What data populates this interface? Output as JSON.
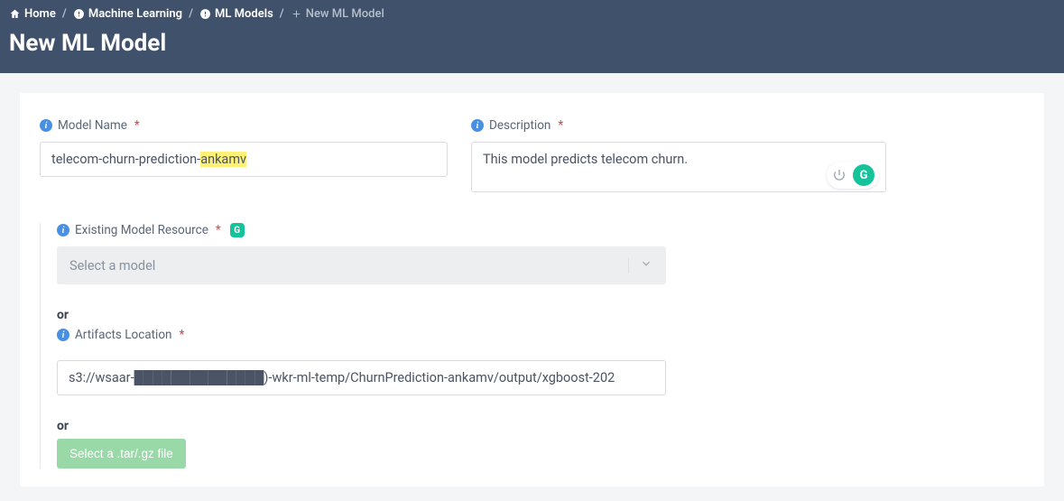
{
  "breadcrumb": {
    "home": "Home",
    "ml": "Machine Learning",
    "models": "ML Models",
    "new": "New ML Model"
  },
  "page_title": "New ML Model",
  "fields": {
    "model_name": {
      "label": "Model Name",
      "value_prefix": "telecom-churn-prediction-",
      "value_highlight": "ankamv"
    },
    "description": {
      "label": "Description",
      "value": "This model predicts telecom churn."
    },
    "existing_resource": {
      "label": "Existing Model Resource",
      "placeholder": "Select a model"
    },
    "artifacts": {
      "label": "Artifacts Location",
      "value": "s3://wsaar-██████████████)-wkr-ml-temp/ChurnPrediction-ankamv/output/xgboost-202"
    }
  },
  "labels": {
    "or": "or",
    "select_file": "Select a .tar/.gz file",
    "grammarly_g": "G"
  }
}
